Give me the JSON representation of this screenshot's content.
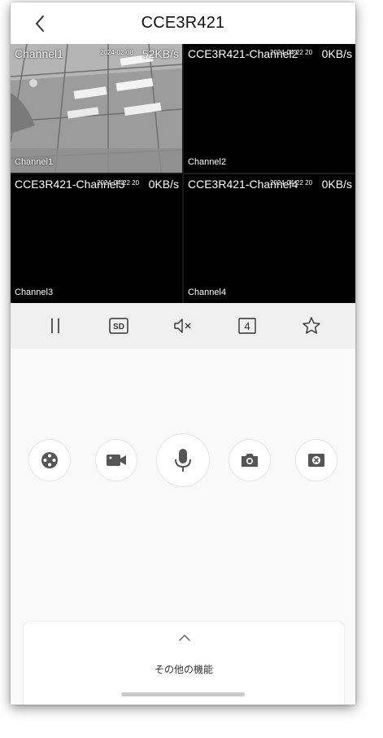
{
  "header": {
    "title": "CCE3R421",
    "back_icon": "chevron-left-icon"
  },
  "channels": [
    {
      "name": "Channel1",
      "time": "2024-02-08",
      "rate": "52KB/s",
      "label": "Channel1",
      "active": true
    },
    {
      "name": "CCE3R421-Channel2",
      "time": "2024-04-22 20",
      "rate": "0KB/s",
      "label": "Channel2",
      "active": false
    },
    {
      "name": "CCE3R421-Channel3",
      "time": "2024-04-22 20",
      "rate": "0KB/s",
      "label": "Channel3",
      "active": false
    },
    {
      "name": "CCE3R421-Channel4",
      "time": "2024-04-22 20",
      "rate": "0KB/s",
      "label": "Channel4",
      "active": false
    }
  ],
  "toolbar": {
    "pause_icon": "pause-icon",
    "quality_label": "SD",
    "mute_icon": "speaker-muted-icon",
    "layout_label": "4",
    "favorite_icon": "star-icon"
  },
  "actions": [
    {
      "name": "ptz-control",
      "icon": "joystick-icon"
    },
    {
      "name": "record-video",
      "icon": "video-camera-icon"
    },
    {
      "name": "talk",
      "icon": "microphone-icon"
    },
    {
      "name": "snapshot",
      "icon": "camera-icon"
    },
    {
      "name": "close-all",
      "icon": "close-window-icon"
    }
  ],
  "more": {
    "label": "その他の機能",
    "chevron_icon": "chevron-up-icon"
  },
  "colors": {
    "active_border": "#3d74c4",
    "icon": "#555555"
  }
}
